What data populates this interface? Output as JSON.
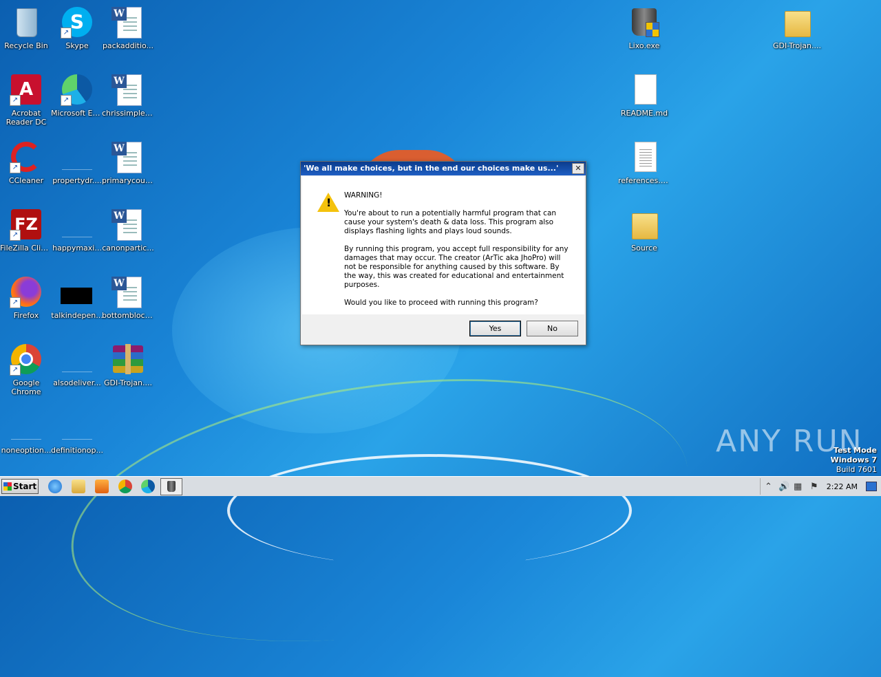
{
  "desktop": {
    "icons": [
      {
        "label": "Recycle Bin"
      },
      {
        "label": "Skype"
      },
      {
        "label": "packadditio..."
      },
      {
        "label": "Lixo.exe"
      },
      {
        "label": "GDI-Trojan...."
      },
      {
        "label": "Acrobat Reader DC"
      },
      {
        "label": "Microsoft Edge"
      },
      {
        "label": "chrissimple.rtf"
      },
      {
        "label": "README.md"
      },
      {
        "label": "CCleaner"
      },
      {
        "label": "propertydr...."
      },
      {
        "label": "primarycoup..."
      },
      {
        "label": "references.txt"
      },
      {
        "label": "FileZilla Client"
      },
      {
        "label": "happymaxi..."
      },
      {
        "label": "canonpartic..."
      },
      {
        "label": "Source"
      },
      {
        "label": "Firefox"
      },
      {
        "label": "talkindepen..."
      },
      {
        "label": "bottomblock..."
      },
      {
        "label": "Google Chrome"
      },
      {
        "label": "alsodeliver..."
      },
      {
        "label": "GDI-Trojan...."
      },
      {
        "label": "noneoption..."
      },
      {
        "label": "definitionop..."
      }
    ]
  },
  "dialog": {
    "title": "'We all make choices, but in the end our choices make us...'",
    "close_glyph": "✕",
    "warning_heading": "WARNING!",
    "paragraph1": "You're about to run a potentially harmful program that can cause your system's death & data loss. This program also displays flashing lights and plays loud sounds.",
    "paragraph2": "By running this program, you accept full responsibility for any damages that may occur. The creator (ArTic aka JhoPro) will not be responsible for anything caused by this software. By the way, this was created for educational and entertainment purposes.",
    "question": "Would you like to proceed with running this program?",
    "yes_label": "Yes",
    "no_label": "No"
  },
  "taskbar": {
    "start_label": "Start",
    "clock": "2:22 AM"
  },
  "watermark": "ANY RUN",
  "test_mode": {
    "line1": "Test Mode",
    "line2": "Windows 7",
    "line3": "Build 7601"
  }
}
